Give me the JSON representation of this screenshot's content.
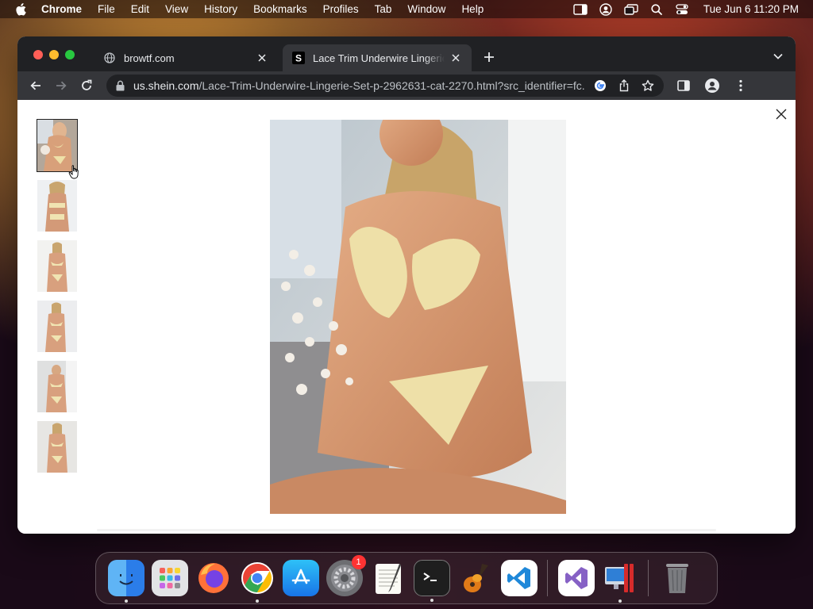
{
  "menubar": {
    "app_name": "Chrome",
    "menus": [
      "File",
      "Edit",
      "View",
      "History",
      "Bookmarks",
      "Profiles",
      "Tab",
      "Window",
      "Help"
    ],
    "clock": "Tue Jun 6  11:20 PM"
  },
  "browser": {
    "tabs": [
      {
        "title": "browtf.com",
        "favicon": "globe-icon",
        "active": false
      },
      {
        "title": "Lace Trim Underwire Lingerie Set",
        "favicon": "shein-s-icon",
        "active": true
      }
    ],
    "favicon_letter": "S",
    "omnibox": {
      "host": "us.shein.com",
      "path": "/Lace-Trim-Underwire-Lingerie-Set-p-2962631-cat-2270.html?src_identifier=fc..."
    }
  },
  "gallery": {
    "thumbnail_count": 6,
    "selected_index": 0
  },
  "dock": {
    "apps": [
      "Finder",
      "Launchpad",
      "Firefox",
      "Google Chrome",
      "App Store",
      "System Preferences",
      "TextEdit",
      "Terminal",
      "GarageBand",
      "Visual Studio Code",
      "Visual Studio",
      "Parallels Desktop",
      "Trash"
    ],
    "settings_badge": "1"
  },
  "colors": {
    "traffic_red": "#ff5f57",
    "traffic_yellow": "#febc2e",
    "traffic_green": "#28c840",
    "tab_bar": "#202124",
    "toolbar": "#35363a"
  }
}
